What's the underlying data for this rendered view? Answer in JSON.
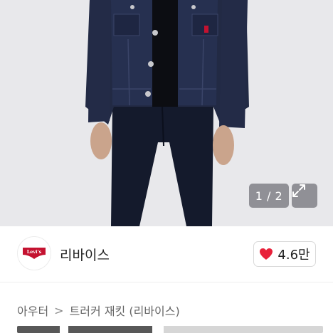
{
  "photo": {
    "pager_text": "1 / 2",
    "expand_icon": "expand-icon"
  },
  "store": {
    "logo_text": "Levi's",
    "name": "리바이스",
    "like_icon": "heart-icon",
    "like_count": "4.6만"
  },
  "breadcrumb": {
    "items": [
      "아우터",
      "트러커 재킷 (리바이스)"
    ],
    "separator": ">"
  },
  "colors": {
    "heart": "#e8213a",
    "logo_red": "#c41230",
    "denim": "#1d2540"
  }
}
